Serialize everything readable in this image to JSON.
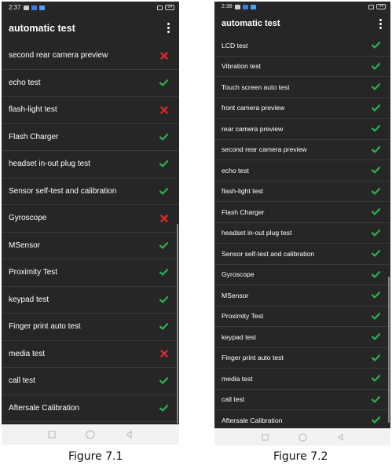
{
  "colors": {
    "pass": "#2bb24c",
    "fail": "#d42a2a",
    "background": "#262626",
    "text": "#ffffff"
  },
  "figure1": {
    "status_time": "2:37",
    "battery": "34",
    "title": "automatic test",
    "more_icon": "more-vert-icon",
    "items": [
      {
        "label": "second rear camera preview",
        "status": "fail"
      },
      {
        "label": "echo test",
        "status": "pass"
      },
      {
        "label": "flash-light test",
        "status": "fail"
      },
      {
        "label": "Flash Charger",
        "status": "pass"
      },
      {
        "label": "headset in-out plug test",
        "status": "pass"
      },
      {
        "label": "Sensor self-test and calibration",
        "status": "pass"
      },
      {
        "label": "Gyroscope",
        "status": "fail"
      },
      {
        "label": "MSensor",
        "status": "pass"
      },
      {
        "label": "Proximity Test",
        "status": "pass"
      },
      {
        "label": "keypad test",
        "status": "pass"
      },
      {
        "label": "Finger print auto test",
        "status": "pass"
      },
      {
        "label": "media test",
        "status": "fail"
      },
      {
        "label": "call test",
        "status": "pass"
      },
      {
        "label": "Aftersale Calibration",
        "status": "pass"
      }
    ],
    "caption": "Figure 7.1"
  },
  "figure2": {
    "status_time": "2:38",
    "battery": "34",
    "title": "automatic test",
    "more_icon": "more-vert-icon",
    "items": [
      {
        "label": "LCD test",
        "status": "pass"
      },
      {
        "label": "Vibration test",
        "status": "pass"
      },
      {
        "label": "Touch screen auto test",
        "status": "pass"
      },
      {
        "label": "front camera preview",
        "status": "pass"
      },
      {
        "label": "rear camera preview",
        "status": "pass"
      },
      {
        "label": "second rear camera preview",
        "status": "pass"
      },
      {
        "label": "echo test",
        "status": "pass"
      },
      {
        "label": "flash-light test",
        "status": "pass"
      },
      {
        "label": "Flash Charger",
        "status": "pass"
      },
      {
        "label": "headset in-out plug test",
        "status": "pass"
      },
      {
        "label": "Sensor self-test and calibration",
        "status": "pass"
      },
      {
        "label": "Gyroscope",
        "status": "pass"
      },
      {
        "label": "MSensor",
        "status": "pass"
      },
      {
        "label": "Proximity Test",
        "status": "pass"
      },
      {
        "label": "keypad test",
        "status": "pass"
      },
      {
        "label": "Finger print auto test",
        "status": "pass"
      },
      {
        "label": "media test",
        "status": "pass"
      },
      {
        "label": "call test",
        "status": "pass"
      },
      {
        "label": "Aftersale Calibration",
        "status": "pass"
      }
    ],
    "caption": "Figure 7.2"
  }
}
